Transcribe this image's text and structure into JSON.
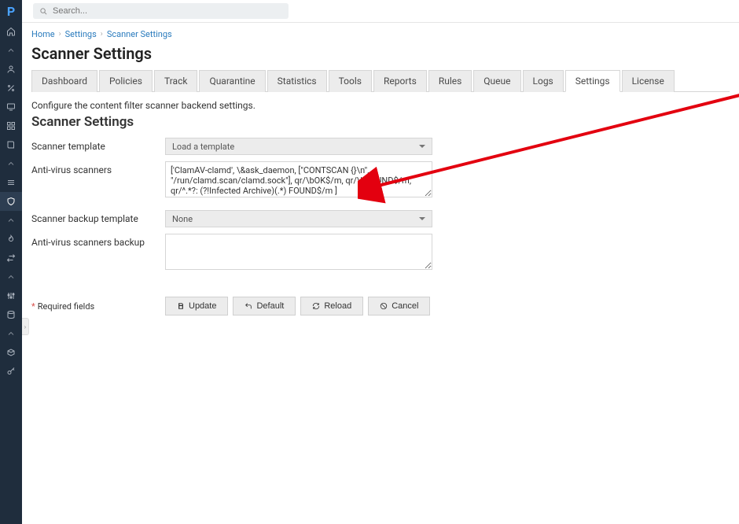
{
  "search": {
    "placeholder": "Search..."
  },
  "breadcrumbs": {
    "home": "Home",
    "settings": "Settings",
    "scanner": "Scanner Settings"
  },
  "page_title": "Scanner Settings",
  "tabs": [
    "Dashboard",
    "Policies",
    "Track",
    "Quarantine",
    "Statistics",
    "Tools",
    "Reports",
    "Rules",
    "Queue",
    "Logs",
    "Settings",
    "License"
  ],
  "active_tab": 10,
  "description": "Configure the content filter scanner backend settings.",
  "section_title": "Scanner Settings",
  "labels": {
    "scanner_template": "Scanner template",
    "av_scanners": "Anti-virus scanners",
    "backup_template": "Scanner backup template",
    "av_backup": "Anti-virus scanners backup"
  },
  "values": {
    "scanner_template": "Load a template",
    "av_scanners": "['ClamAV-clamd', \\&ask_daemon, [\"CONTSCAN {}\\n\", \"/run/clamd.scan/clamd.sock\"], qr/\\bOK$/m, qr/\\bFOUND$/m, qr/^.*?: (?!Infected Archive)(.*) FOUND$/m ]",
    "backup_template": "None",
    "av_backup": ""
  },
  "required_note": "Required fields",
  "buttons": {
    "update": "Update",
    "default": "Default",
    "reload": "Reload",
    "cancel": "Cancel"
  },
  "sidebar_icons": [
    "home",
    "user",
    "percent",
    "monitor",
    "grid",
    "book",
    "bars",
    "shield",
    "flame",
    "exchange",
    "sliders",
    "db",
    "box",
    "key"
  ]
}
